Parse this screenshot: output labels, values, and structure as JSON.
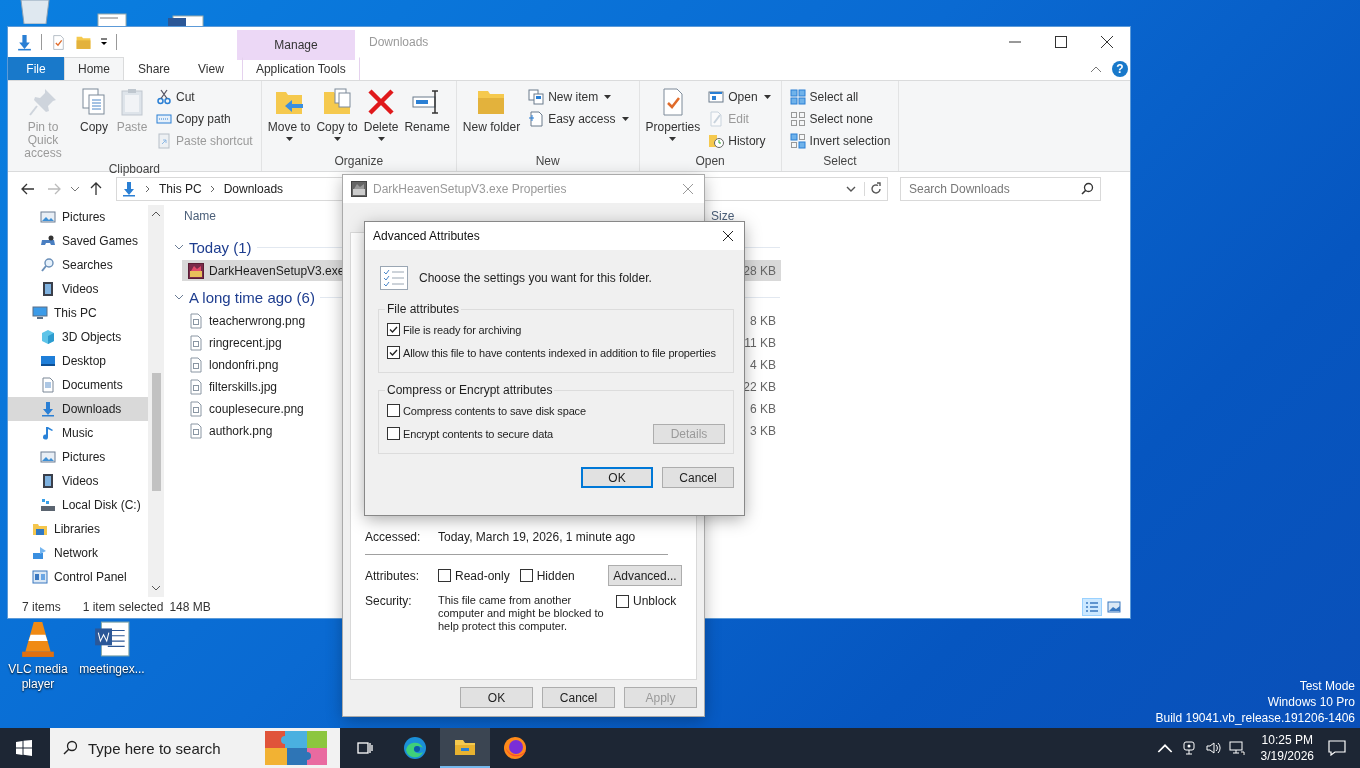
{
  "desktop": {
    "icons": [
      {
        "label": "VLC media player"
      },
      {
        "label": "meetingex..."
      }
    ],
    "watermark": [
      "Test Mode",
      "Windows 10 Pro",
      "Build 19041.vb_release.191206-1406"
    ]
  },
  "explorer": {
    "title": "Downloads",
    "context_tab": "Manage",
    "tabs": [
      {
        "label": "File",
        "kind": "file",
        "selected": false
      },
      {
        "label": "Home",
        "kind": "tab",
        "selected": true
      },
      {
        "label": "Share",
        "kind": "tab",
        "selected": false
      },
      {
        "label": "View",
        "kind": "tab",
        "selected": false
      },
      {
        "label": "Application Tools",
        "kind": "context",
        "selected": false
      }
    ],
    "help": "?",
    "ribbon": [
      {
        "label": "Clipboard",
        "items": [
          {
            "kind": "large",
            "label": "Pin to Quick access",
            "dropdown": false,
            "disabled": true
          },
          {
            "kind": "large",
            "label": "Copy",
            "dropdown": false,
            "disabled": false
          },
          {
            "kind": "large",
            "label": "Paste",
            "dropdown": false,
            "disabled": true
          },
          {
            "kind": "stack",
            "items": [
              {
                "label": "Cut",
                "dropdown": false,
                "disabled": false
              },
              {
                "label": "Copy path",
                "dropdown": false,
                "disabled": false
              },
              {
                "label": "Paste shortcut",
                "dropdown": false,
                "disabled": true
              }
            ]
          }
        ]
      },
      {
        "label": "Organize",
        "items": [
          {
            "kind": "large",
            "label": "Move to",
            "dropdown": true,
            "disabled": false
          },
          {
            "kind": "large",
            "label": "Copy to",
            "dropdown": true,
            "disabled": false
          },
          {
            "kind": "large",
            "label": "Delete",
            "dropdown": true,
            "disabled": false
          },
          {
            "kind": "large",
            "label": "Rename",
            "dropdown": false,
            "disabled": false
          }
        ]
      },
      {
        "label": "New",
        "items": [
          {
            "kind": "large",
            "label": "New folder",
            "dropdown": false,
            "disabled": false
          },
          {
            "kind": "stack",
            "items": [
              {
                "label": "New item",
                "dropdown": true,
                "disabled": false
              },
              {
                "label": "Easy access",
                "dropdown": true,
                "disabled": false
              }
            ]
          }
        ]
      },
      {
        "label": "Open",
        "items": [
          {
            "kind": "large",
            "label": "Properties",
            "dropdown": true,
            "disabled": false
          },
          {
            "kind": "stack",
            "items": [
              {
                "label": "Open",
                "dropdown": true,
                "disabled": false
              },
              {
                "label": "Edit",
                "dropdown": false,
                "disabled": true
              },
              {
                "label": "History",
                "dropdown": false,
                "disabled": false
              }
            ]
          }
        ]
      },
      {
        "label": "Select",
        "items": [
          {
            "kind": "stack",
            "items": [
              {
                "label": "Select all",
                "dropdown": false,
                "disabled": false
              },
              {
                "label": "Select none",
                "dropdown": false,
                "disabled": false
              },
              {
                "label": "Invert selection",
                "dropdown": false,
                "disabled": false
              }
            ]
          }
        ]
      }
    ],
    "address": {
      "path": [
        "This PC",
        "Downloads"
      ],
      "search_placeholder": "Search Downloads"
    },
    "nav": [
      {
        "children": [
          {
            "label": "Pictures",
            "selected": false
          },
          {
            "label": "Saved Games",
            "selected": false
          },
          {
            "label": "Searches",
            "selected": false
          },
          {
            "label": "Videos",
            "selected": false
          }
        ]
      },
      {
        "label": "This PC",
        "selected": false,
        "children": [
          {
            "label": "3D Objects",
            "selected": false
          },
          {
            "label": "Desktop",
            "selected": false
          },
          {
            "label": "Documents",
            "selected": false
          },
          {
            "label": "Downloads",
            "selected": true
          },
          {
            "label": "Music",
            "selected": false
          },
          {
            "label": "Pictures",
            "selected": false
          },
          {
            "label": "Videos",
            "selected": false
          },
          {
            "label": "Local Disk (C:)",
            "selected": false
          }
        ]
      },
      {
        "label": "Libraries",
        "selected": false
      },
      {
        "label": "Network",
        "selected": false
      },
      {
        "label": "Control Panel",
        "selected": false
      }
    ],
    "columns": [
      "Name",
      "Size"
    ],
    "groups": [
      {
        "label": "Today (1)",
        "expanded": true,
        "files": [
          {
            "name": "DarkHeavenSetupV3.exe",
            "kind": "app",
            "size": "28 KB",
            "selected": true
          }
        ]
      },
      {
        "label": "A long time ago (6)",
        "expanded": true,
        "files": [
          {
            "name": "teacherwrong.png",
            "size": "8 KB",
            "selected": false
          },
          {
            "name": "ringrecent.jpg",
            "size": "11 KB",
            "selected": false
          },
          {
            "name": "londonfri.png",
            "size": "4 KB",
            "selected": false
          },
          {
            "name": "filterskills.jpg",
            "size": "22 KB",
            "selected": false
          },
          {
            "name": "couplesecure.png",
            "size": "6 KB",
            "selected": false
          },
          {
            "name": "authork.png",
            "size": "3 KB",
            "selected": false
          }
        ]
      }
    ],
    "status": [
      "7 items",
      "1 item selected",
      "148 MB"
    ],
    "views": [
      {
        "kind": "details",
        "selected": true
      },
      {
        "kind": "large",
        "selected": false
      }
    ]
  },
  "properties": {
    "title": "DarkHeavenSetupV3.exe Properties",
    "accessed_label": "Accessed:",
    "accessed": "Today, March 19, 2026, 1 minute ago",
    "attributes_label": "Attributes:",
    "attributes": [
      {
        "label": "Read-only",
        "checked": false
      },
      {
        "label": "Hidden",
        "checked": false
      }
    ],
    "advanced_button": "Advanced...",
    "security_label": "Security:",
    "security_text": "This file came from another computer and might be blocked to help protect this computer.",
    "unblock": {
      "label": "Unblock",
      "checked": false
    },
    "buttons": [
      {
        "label": "OK",
        "disabled": false
      },
      {
        "label": "Cancel",
        "disabled": false
      },
      {
        "label": "Apply",
        "disabled": true
      }
    ]
  },
  "advanced": {
    "title": "Advanced Attributes",
    "intro": "Choose the settings you want for this folder.",
    "sections": [
      {
        "label": "File attributes",
        "options": [
          {
            "label": "File is ready for archiving",
            "checked": true
          },
          {
            "label": "Allow this file to have contents indexed in addition to file properties",
            "checked": true
          }
        ]
      },
      {
        "label": "Compress or Encrypt attributes",
        "options": [
          {
            "label": "Compress contents to save disk space",
            "checked": false
          },
          {
            "label": "Encrypt contents to secure data",
            "checked": false
          }
        ],
        "button": {
          "label": "Details",
          "disabled": true
        }
      }
    ],
    "buttons": [
      {
        "label": "OK",
        "default": true
      },
      {
        "label": "Cancel",
        "default": false
      }
    ]
  },
  "taskbar": {
    "search_placeholder": "Type here to search",
    "apps": [
      {
        "kind": "taskview",
        "active": false
      },
      {
        "kind": "edge",
        "active": false
      },
      {
        "kind": "explorer",
        "active": true
      },
      {
        "kind": "firefox",
        "active": false
      }
    ],
    "time": "10:25 PM",
    "date": "3/19/2026"
  }
}
